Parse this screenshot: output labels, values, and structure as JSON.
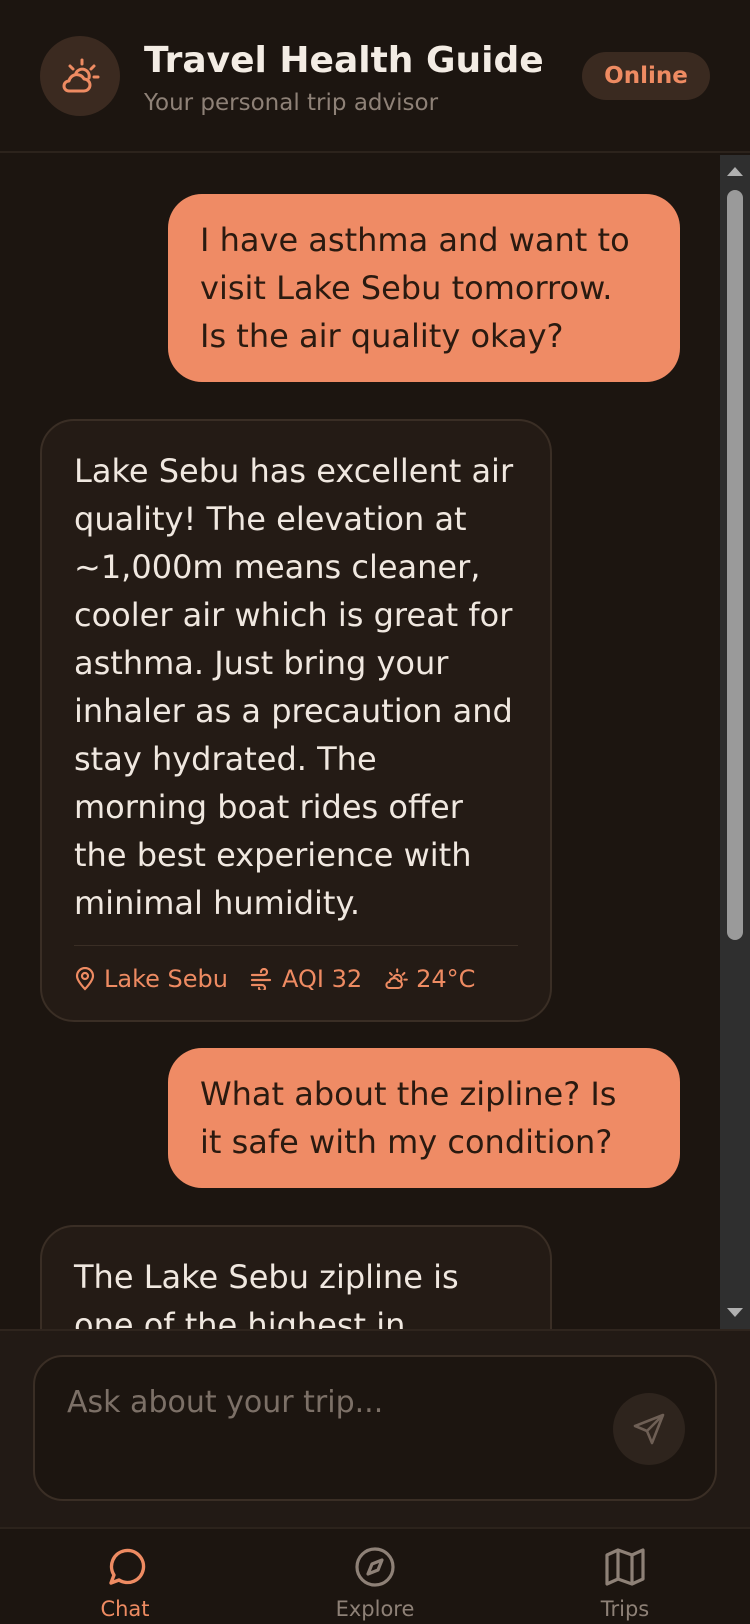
{
  "header": {
    "title": "Travel Health Guide",
    "subtitle": "Your personal trip advisor",
    "status": "Online",
    "avatar_icon": "weather-sun-cloud-icon"
  },
  "messages": [
    {
      "role": "user",
      "text": "I have asthma and want to visit Lake Sebu tomorrow. Is the air quality okay?"
    },
    {
      "role": "assistant",
      "text": "Lake Sebu has excellent air quality! The elevation at ~1,000m means cleaner, cooler air which is great for asthma. Just bring your inhaler as a precaution and stay hydrated. The morning boat rides offer the best experience with minimal humidity.",
      "meta": {
        "location": "Lake Sebu",
        "aqi": "AQI 32",
        "temp": "24°C"
      }
    },
    {
      "role": "user",
      "text": "What about the zipline? Is it safe with my condition?"
    },
    {
      "role": "assistant",
      "text": "The Lake Sebu zipline is one of the highest in Southeast"
    }
  ],
  "composer": {
    "placeholder": "Ask about your trip...",
    "value": ""
  },
  "nav": {
    "items": [
      {
        "label": "Chat",
        "icon": "chat-bubble-icon",
        "active": true
      },
      {
        "label": "Explore",
        "icon": "compass-icon",
        "active": false
      },
      {
        "label": "Trips",
        "icon": "map-icon",
        "active": false
      }
    ]
  },
  "colors": {
    "accent": "#ee8b62",
    "user_bubble": "#ef8b65",
    "bg": "#1c1510",
    "bot_bubble": "#241b15",
    "muted": "#8e8177"
  }
}
